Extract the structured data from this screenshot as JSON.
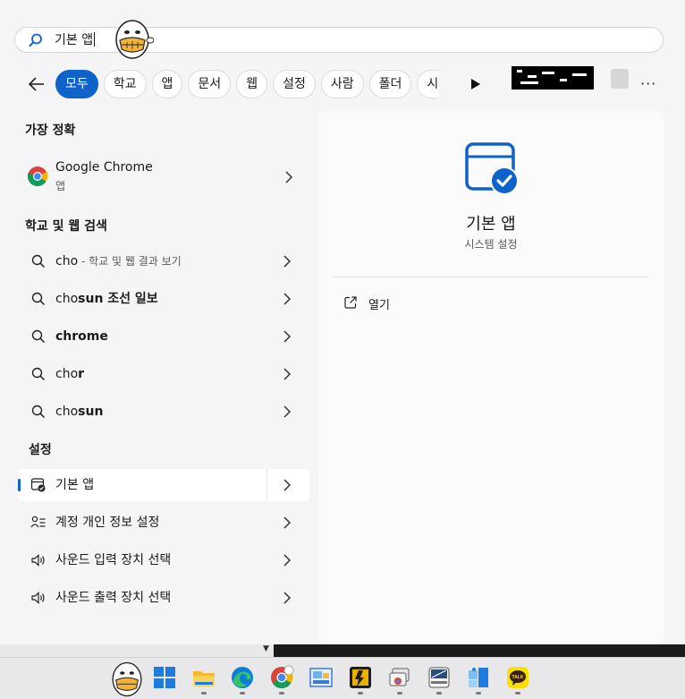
{
  "search": {
    "query": "기본 앱"
  },
  "filters": {
    "chips": [
      "모두",
      "학교",
      "앱",
      "문서",
      "웹",
      "설정",
      "사람",
      "폴더",
      "시"
    ],
    "active": "모두"
  },
  "best_match": {
    "title": "가장 정확",
    "item": {
      "name": "Google Chrome",
      "type": "앱"
    }
  },
  "web_search": {
    "title": "학교 및 웹 검색",
    "items": [
      {
        "query": "cho",
        "suffix": "학교 및 웹 결과 보기"
      },
      {
        "prefix": "cho",
        "rest": "sun 조선 일보"
      },
      {
        "prefix": "",
        "rest": "chrome"
      },
      {
        "prefix": "cho",
        "rest": "r"
      },
      {
        "prefix": "cho",
        "rest": "sun"
      }
    ]
  },
  "settings": {
    "title": "설정",
    "items": [
      {
        "label": "기본 앱",
        "icon": "default-apps-icon",
        "selected": true
      },
      {
        "label": "계정 개인 정보 설정",
        "icon": "account-privacy-icon"
      },
      {
        "label": "사운드 입력 장치 선택",
        "icon": "speaker-icon"
      },
      {
        "label": "사운드 출력 장치 선택",
        "icon": "speaker-icon"
      }
    ]
  },
  "preview": {
    "title": "기본 앱",
    "subtitle": "시스템 설정",
    "actions": [
      {
        "label": "열기",
        "icon": "open-external-icon"
      }
    ]
  },
  "taskbar": {
    "apps": [
      "sticker-icon",
      "windows-start-icon",
      "file-explorer-icon",
      "edge-icon",
      "chrome-icon",
      "photo-viewer-icon",
      "app-icon",
      "remote-desktop-icon",
      "flashcard-app-icon",
      "todo-app-icon",
      "kakaotalk-icon"
    ]
  },
  "colors": {
    "accent": "#0f62c9"
  }
}
